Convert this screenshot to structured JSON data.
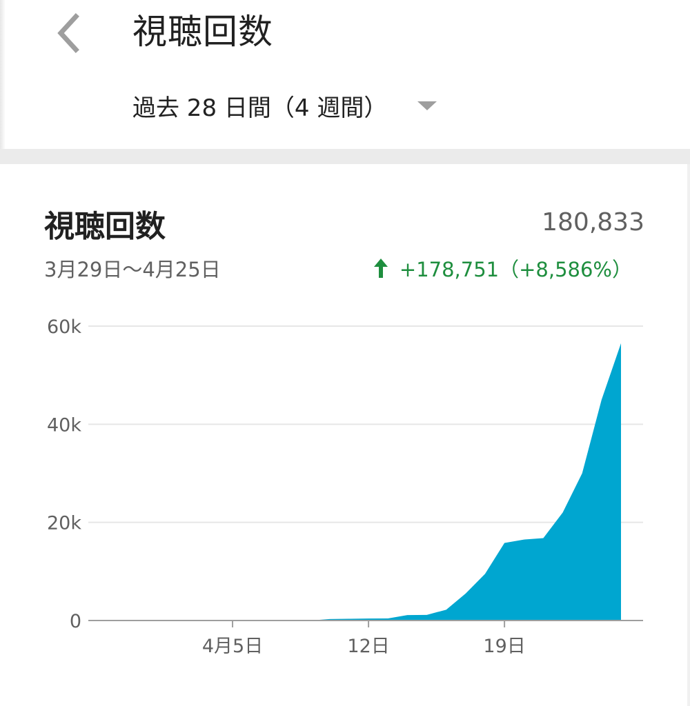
{
  "header": {
    "title": "視聴回数",
    "period": "過去 28 日間（4 週間）"
  },
  "card": {
    "title": "視聴回数",
    "total": "180,833",
    "date_range": "3月29日～4月25日",
    "change": "+178,751（+8,586%）"
  },
  "colors": {
    "area": "#00a6d0",
    "change_text": "#1e8e3e",
    "grid": "#e6e6e6",
    "axis": "#9e9e9e"
  },
  "chart_data": {
    "type": "area",
    "x": [
      1,
      2,
      3,
      4,
      5,
      6,
      7,
      8,
      9,
      10,
      11,
      12,
      13,
      14,
      15,
      16,
      17,
      18,
      19,
      20,
      21,
      22,
      23,
      24,
      25,
      26,
      27,
      28
    ],
    "values": [
      0,
      0,
      0,
      0,
      0,
      0,
      0,
      0,
      0,
      0,
      0,
      0,
      300,
      350,
      400,
      420,
      1100,
      1150,
      2200,
      5500,
      9500,
      15800,
      16500,
      16800,
      22000,
      30000,
      45000,
      56500
    ],
    "xticks": [
      {
        "x": 8,
        "label": "4月5日"
      },
      {
        "x": 15,
        "label": "12日"
      },
      {
        "x": 22,
        "label": "19日"
      }
    ],
    "yticks": [
      {
        "value": 0,
        "label": "0"
      },
      {
        "value": 20000,
        "label": "20k"
      },
      {
        "value": 40000,
        "label": "40k"
      },
      {
        "value": 60000,
        "label": "60k"
      }
    ],
    "ylim": [
      0,
      60000
    ],
    "grid": true
  }
}
